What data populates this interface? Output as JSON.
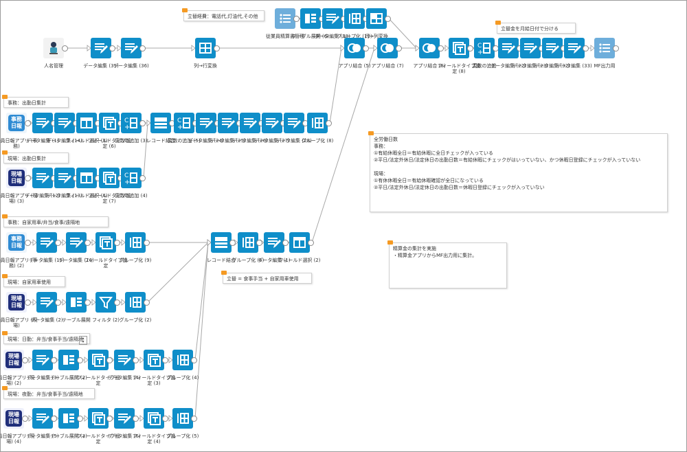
{
  "nodes": {
    "n1": {
      "label": "人名管理"
    },
    "n2": {
      "label": "データ編集 (35)"
    },
    "n3": {
      "label": "データ編集 (36)"
    },
    "n4": {
      "label": "列→行変換"
    },
    "n5": {
      "label": "従業員精算書管理"
    },
    "n6": {
      "label": "テーブル展開 (6)"
    },
    "n7": {
      "label": "データ編集 (38)"
    },
    "n8": {
      "label": "グループ化 (10)"
    },
    "n9": {
      "label": "行→列変換"
    },
    "n10": {
      "label": "アプリ結合 (5)"
    },
    "n11": {
      "label": "アプリ結合 (7)"
    },
    "n12": {
      "label": "アプリ結合 (8)"
    },
    "n13": {
      "label": "フィールドタイプ設定 (8)"
    },
    "n14": {
      "label": "変数の追加"
    },
    "n15": {
      "label": "データ編集 (22)"
    },
    "n16": {
      "label": "データ編集 (23)"
    },
    "n17": {
      "label": "データ編集 (32)"
    },
    "n18": {
      "label": "データ編集 (33)"
    },
    "n19": {
      "label": "MF出力用"
    },
    "r2_1": {
      "label": "社員日報アプリ (事務)"
    },
    "r2_2": {
      "label": "データ編集 (1)"
    },
    "r2_3": {
      "label": "データ編集 (14)"
    },
    "r2_4": {
      "label": "フィールド選択 (3)"
    },
    "r2_5": {
      "label": "フィールドタイプ設定 (6)"
    },
    "r2_6": {
      "label": "変数の追加 (3)"
    },
    "r2_7": {
      "label": "レコード結合"
    },
    "r2_8": {
      "label": "変数の追加 (5)"
    },
    "r2_9": {
      "label": "データ編集 (24)"
    },
    "r2_10": {
      "label": "データ編集 (25)"
    },
    "r2_11": {
      "label": "データ編集 (26)"
    },
    "r2_12": {
      "label": "データ編集 (27)"
    },
    "r2_13": {
      "label": "データ編集 (28)"
    },
    "r2_14": {
      "label": "グループ化 (8)"
    },
    "r3_1": {
      "label": "社員日報アプリ (現場) (3)"
    },
    "r3_2": {
      "label": "データ編集 (12)"
    },
    "r3_3": {
      "label": "データ編集 (13)"
    },
    "r3_4": {
      "label": "フィールド選択 (4)"
    },
    "r3_5": {
      "label": "フィールドタイプ設定 (7)"
    },
    "r3_6": {
      "label": "変数の追加 (4)"
    },
    "r4_1": {
      "label": "社員日報アプリ (事務) (2)"
    },
    "r4_2": {
      "label": "データ編集 (15)"
    },
    "r4_3": {
      "label": "データ編集 (16)"
    },
    "r4_4": {
      "label": "フィールドタイプ設定"
    },
    "r4_5": {
      "label": "グループ化 (9)"
    },
    "m1": {
      "label": "レコード結合"
    },
    "m2": {
      "label": "グループ化 (6)"
    },
    "m3": {
      "label": "データ編集 (1)"
    },
    "m4": {
      "label": "フィールド選択 (2)"
    },
    "r5_1": {
      "label": "社員日報アプリ (現場)"
    },
    "r5_2": {
      "label": "データ編集 (2)"
    },
    "r5_3": {
      "label": "テーブル展開"
    },
    "r5_4": {
      "label": "フィルタ (2)"
    },
    "r5_5": {
      "label": "グループ化 (2)"
    },
    "r6_1": {
      "label": "社員日報アプリ (現場) (2)"
    },
    "r6_2": {
      "label": "データ編集 (3)"
    },
    "r6_3": {
      "label": "テーブル展開 (2)"
    },
    "r6_4": {
      "label": "フィールドタイプ設定"
    },
    "r6_5": {
      "label": "データ編集 (4)"
    },
    "r6_6": {
      "label": "フィールドタイプ設定 (3)"
    },
    "r6_7": {
      "label": "グループ化 (4)"
    },
    "r7_1": {
      "label": "社員日報アプリ (現場) (4)"
    },
    "r7_2": {
      "label": "データ編集 (5)"
    },
    "r7_3": {
      "label": "テーブル展開 (3)"
    },
    "r7_4": {
      "label": "フィールドタイプ設定"
    },
    "r7_5": {
      "label": "データ編集 (6)"
    },
    "r7_6": {
      "label": "フィールドタイプ設定 (4)"
    },
    "r7_7": {
      "label": "グループ化 (5)"
    }
  },
  "app_badges": {
    "jimu": "事務\n日報",
    "genba": "現場\n日報"
  },
  "notes": {
    "top": {
      "lines": [
        "立替経費：電話代,灯油代,その他"
      ]
    },
    "payday": {
      "lines": [
        "立替金を月給日付で分ける"
      ]
    },
    "jimu_attend": {
      "lines": [
        "事務：出勤日集計"
      ]
    },
    "genba_attend": {
      "lines": [
        "現場：出勤日集計"
      ]
    },
    "jimu_car": {
      "lines": [
        "事務：自家用車/弁当/食事/遠隔地"
      ]
    },
    "genba_car": {
      "lines": [
        "現場：自家用車使用"
      ]
    },
    "meal_formula": {
      "lines": [
        "立替 = 食事手当 + 自家用車使用"
      ]
    },
    "genba_daily": {
      "lines": [
        "現場：日勤：弁当/食事手当/遠隔地"
      ]
    },
    "genba_night": {
      "lines": [
        "現場：夜勤：弁当/食事手当/遠隔地"
      ]
    },
    "workdays": {
      "lines": [
        "全労働日数",
        "事務：",
        "①有給休暇全日＝有給休暇に全日チェックが入っている",
        "②平日/法定外休日/法定休日の出勤日数＝有給休暇にチェックがはいっていない、かつ休暇日登録にチェックが入っていない",
        "",
        "現場：",
        "①有休休暇全日＝有給休暇確認が全日になっている",
        "②平日/法定外休日/法定休日の出勤日数＝休暇日登録にチェックが入っていない"
      ]
    },
    "settle": {
      "lines": [
        "精算金の集計を実施",
        "・精算金アプリからMF出力用に集計。"
      ]
    }
  },
  "colors": {
    "node": "#0f8ec9",
    "node_light": "#6eaedb",
    "wire": "#a8a8a8",
    "note_tag": "#f59a23"
  }
}
